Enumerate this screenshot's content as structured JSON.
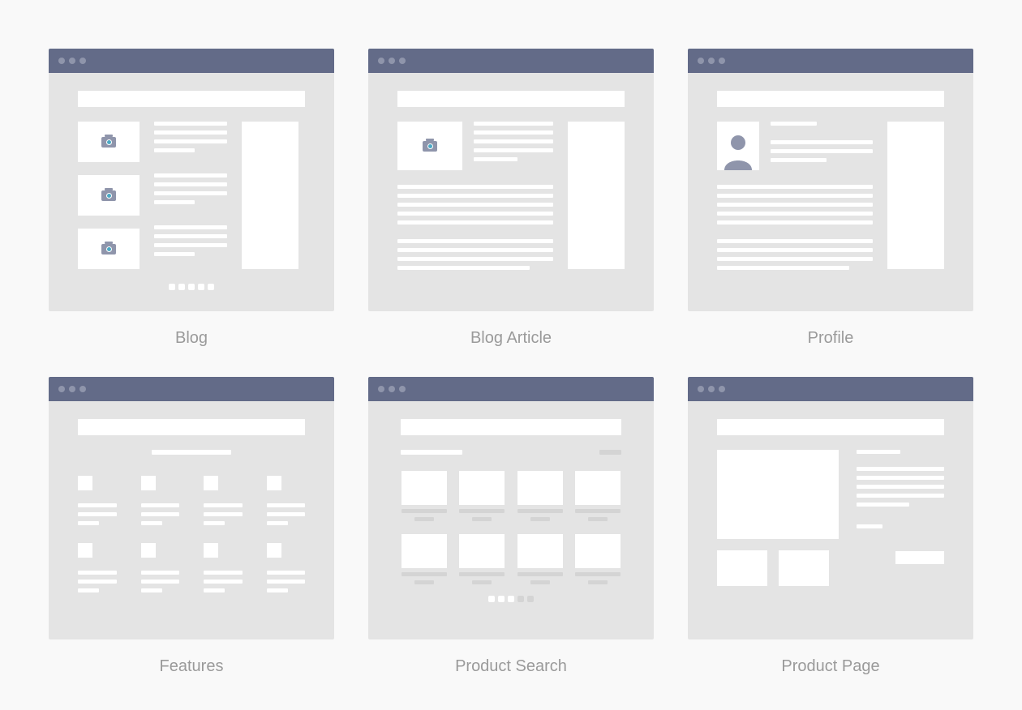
{
  "wireframes": [
    {
      "id": "blog",
      "label": "Blog"
    },
    {
      "id": "blog-article",
      "label": "Blog Article"
    },
    {
      "id": "profile",
      "label": "Profile"
    },
    {
      "id": "features",
      "label": "Features"
    },
    {
      "id": "product-search",
      "label": "Product Search"
    },
    {
      "id": "product-page",
      "label": "Product Page"
    }
  ],
  "colors": {
    "titlebar": "#636b88",
    "canvas": "#e4e4e4",
    "block": "#ffffff",
    "avatar": "#8f95ab",
    "camera_lens": "#4aa8c4"
  }
}
